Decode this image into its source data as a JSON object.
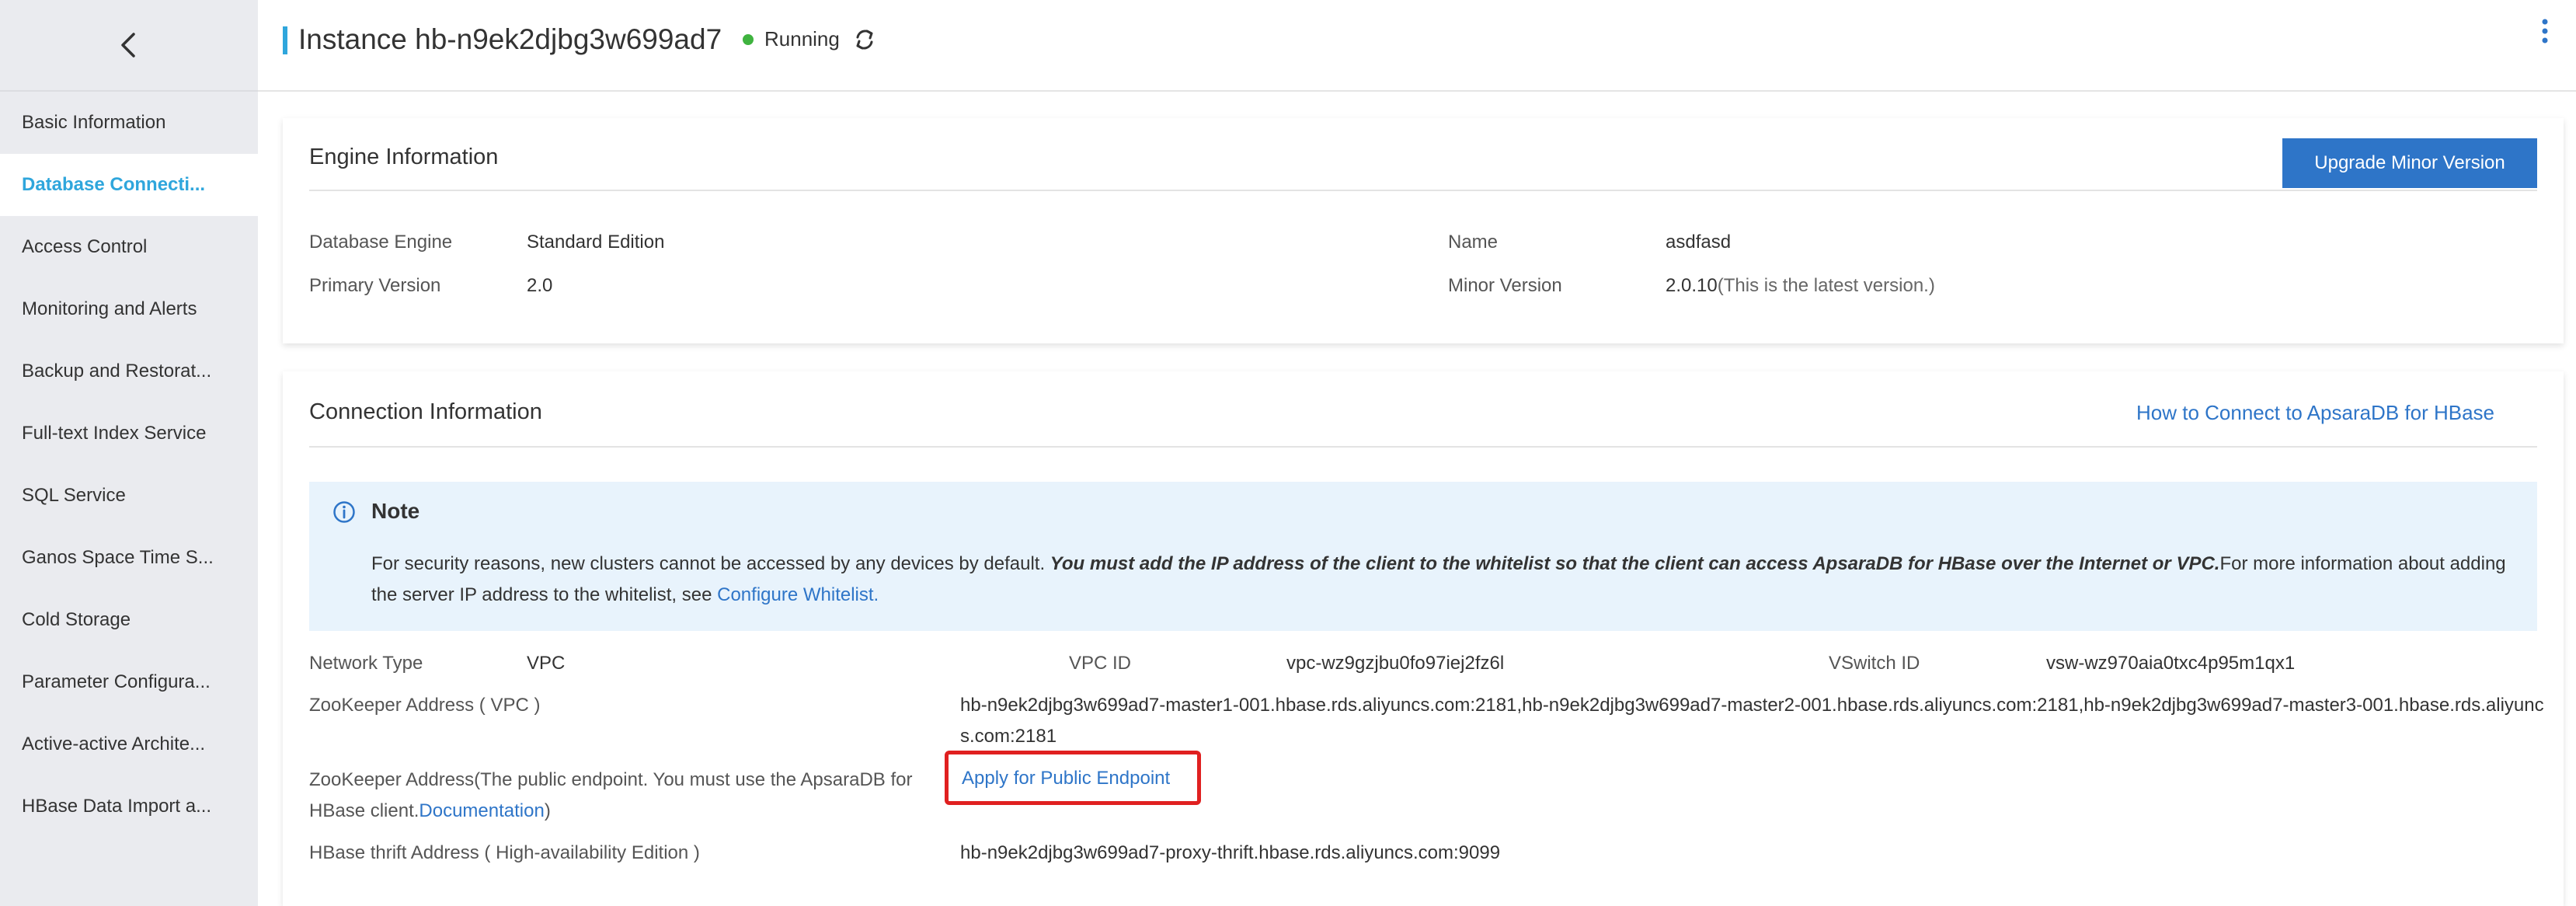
{
  "header": {
    "title": "Instance hb-n9ek2djbg3w699ad7",
    "status": "Running"
  },
  "sidebar": {
    "items": [
      {
        "label": "Basic Information"
      },
      {
        "label": "Database Connecti..."
      },
      {
        "label": "Access Control"
      },
      {
        "label": "Monitoring and Alerts"
      },
      {
        "label": "Backup and Restorat..."
      },
      {
        "label": "Full-text Index Service"
      },
      {
        "label": "SQL Service"
      },
      {
        "label": "Ganos Space Time S..."
      },
      {
        "label": "Cold Storage"
      },
      {
        "label": "Parameter Configura..."
      },
      {
        "label": "Active-active Archite..."
      },
      {
        "label": "HBase Data Import a..."
      }
    ],
    "active_index": 1
  },
  "engine": {
    "title": "Engine Information",
    "upgrade_button": "Upgrade Minor Version",
    "database_engine_label": "Database Engine",
    "database_engine_value": "Standard Edition",
    "primary_version_label": "Primary Version",
    "primary_version_value": "2.0",
    "name_label": "Name",
    "name_value": "asdfasd",
    "minor_version_label": "Minor Version",
    "minor_version_value": "2.0.10",
    "minor_version_note": "(This is the latest version.)"
  },
  "connection": {
    "title": "Connection Information",
    "help_link": "How to Connect to ApsaraDB for HBase",
    "note": {
      "title": "Note",
      "text_before": "For security reasons, new clusters cannot be accessed by any devices by default. ",
      "text_bold": "You must add the IP address of the client to the whitelist so that the client can access ApsaraDB for HBase over the Internet or VPC.",
      "text_after": "For more information about adding the server IP address to the whitelist, see ",
      "link": "Configure Whitelist."
    },
    "network_type_label": "Network Type",
    "network_type_value": "VPC",
    "vpc_id_label": "VPC ID",
    "vpc_id_value": "vpc-wz9gzjbu0fo97iej2fz6l",
    "vswitch_id_label": "VSwitch ID",
    "vswitch_id_value": "vsw-wz970aia0txc4p95m1qx1",
    "zk_vpc_label": "ZooKeeper Address ( VPC )",
    "zk_vpc_value": "hb-n9ek2djbg3w699ad7-master1-001.hbase.rds.aliyuncs.com:2181,hb-n9ek2djbg3w699ad7-master2-001.hbase.rds.aliyuncs.com:2181,hb-n9ek2djbg3w699ad7-master3-001.hbase.rds.aliyuncs.com:2181",
    "zk_public_label_before": "ZooKeeper Address(The public endpoint. You must use the ApsaraDB for HBase client.",
    "zk_public_label_link": "Documentation",
    "zk_public_label_after": ")",
    "apply_public_link": "Apply for Public Endpoint",
    "thrift_label": "HBase thrift Address ( High-availability Edition )",
    "thrift_value": "hb-n9ek2djbg3w699ad7-proxy-thrift.hbase.rds.aliyuncs.com:9099"
  },
  "colors": {
    "accent": "#2fa6dc",
    "link": "#2e75c8",
    "status_running": "#3fb33f",
    "highlight": "#e02020",
    "note_bg": "#e8f3fc"
  }
}
